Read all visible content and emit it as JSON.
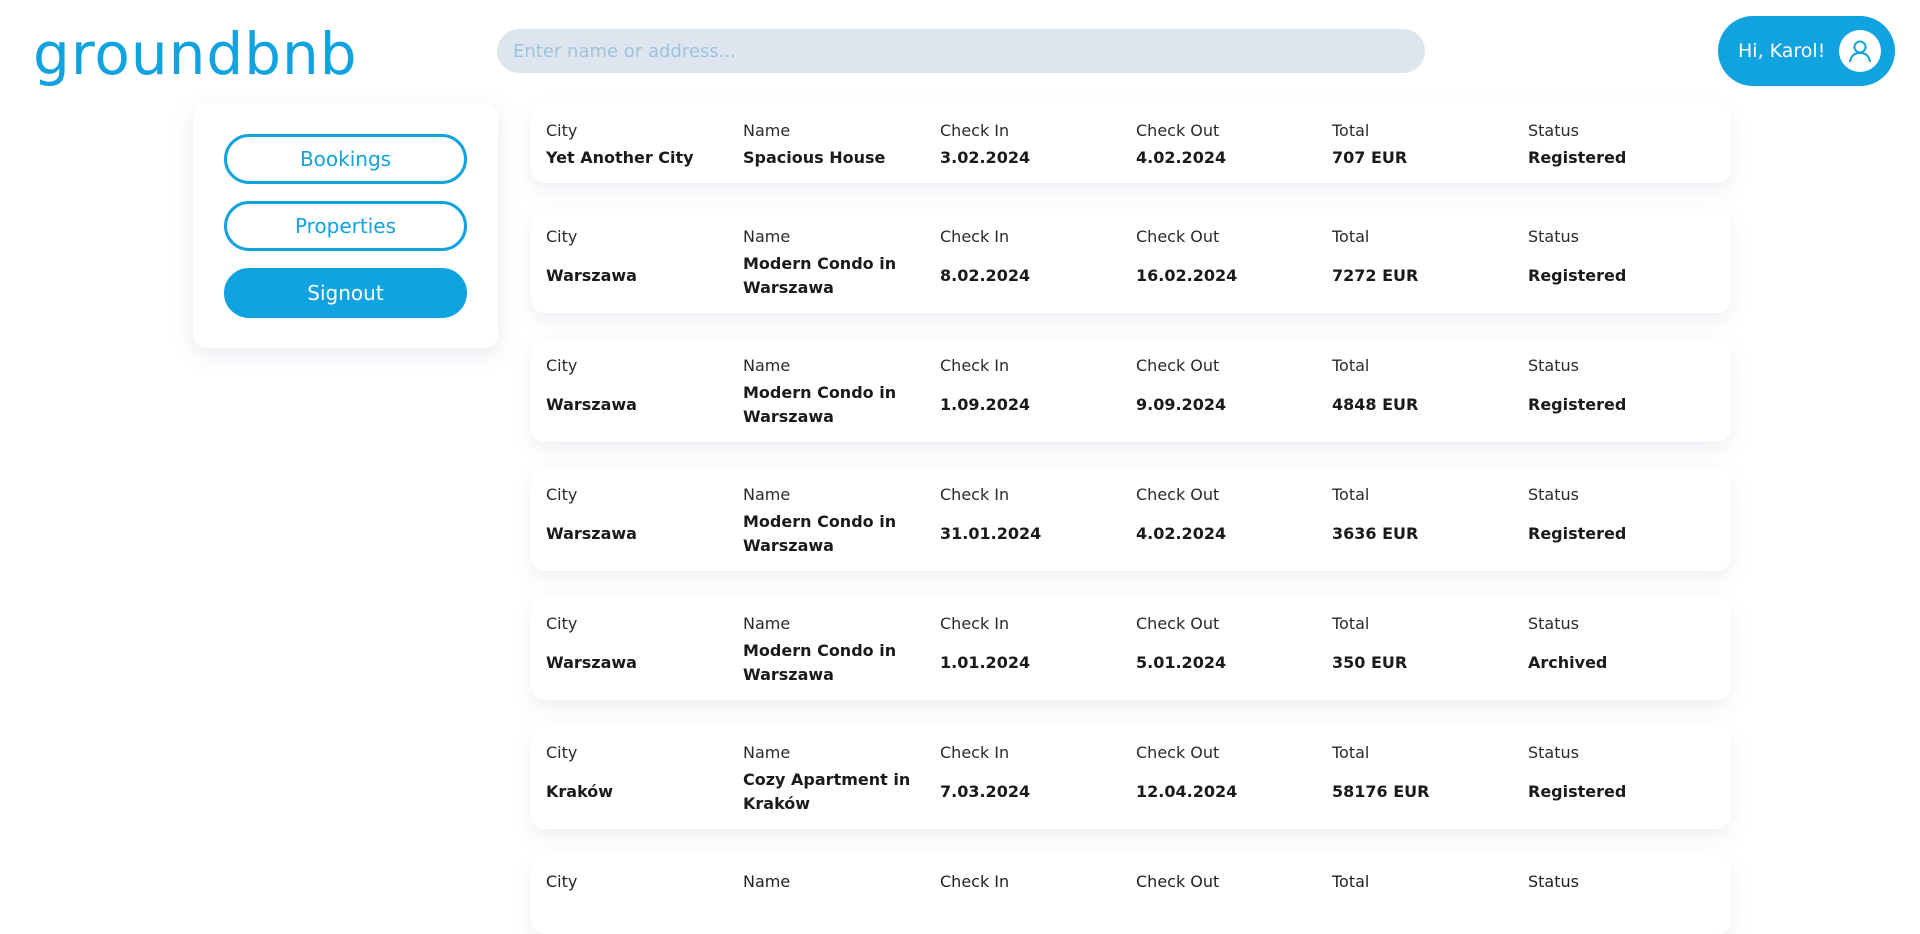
{
  "header": {
    "logo": "groundbnb",
    "search_placeholder": "Enter name or address...",
    "greeting": "Hi, Karol!",
    "avatar_icon": "user-icon"
  },
  "sidebar": {
    "buttons": [
      {
        "label": "Bookings"
      },
      {
        "label": "Properties"
      },
      {
        "label": "Signout"
      }
    ]
  },
  "columns": {
    "city": "City",
    "name": "Name",
    "check_in": "Check In",
    "check_out": "Check Out",
    "total": "Total",
    "status": "Status"
  },
  "bookings": [
    {
      "city": "Yet Another City",
      "name": "Spacious House",
      "check_in": "3.02.2024",
      "check_out": "4.02.2024",
      "total": "707 EUR",
      "status": "Registered"
    },
    {
      "city": "Warszawa",
      "name": "Modern Condo in Warszawa",
      "check_in": "8.02.2024",
      "check_out": "16.02.2024",
      "total": "7272 EUR",
      "status": "Registered"
    },
    {
      "city": "Warszawa",
      "name": "Modern Condo in Warszawa",
      "check_in": "1.09.2024",
      "check_out": "9.09.2024",
      "total": "4848 EUR",
      "status": "Registered"
    },
    {
      "city": "Warszawa",
      "name": "Modern Condo in Warszawa",
      "check_in": "31.01.2024",
      "check_out": "4.02.2024",
      "total": "3636 EUR",
      "status": "Registered"
    },
    {
      "city": "Warszawa",
      "name": "Modern Condo in Warszawa",
      "check_in": "1.01.2024",
      "check_out": "5.01.2024",
      "total": "350 EUR",
      "status": "Archived"
    },
    {
      "city": "Kraków",
      "name": "Cozy Apartment in Kraków",
      "check_in": "7.03.2024",
      "check_out": "12.04.2024",
      "total": "58176 EUR",
      "status": "Registered"
    }
  ],
  "colors": {
    "accent": "#10a3e0",
    "search_bg": "#dde6ee"
  }
}
